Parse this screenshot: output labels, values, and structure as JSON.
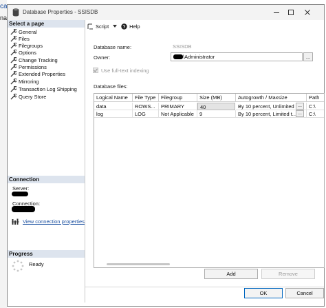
{
  "background": {
    "frag1": "ca",
    "frag2": "na"
  },
  "window": {
    "title": "Database Properties - SSISDB"
  },
  "left_pane": {
    "select_page_header": "Select a page",
    "pages": [
      {
        "label": "General"
      },
      {
        "label": "Files"
      },
      {
        "label": "Filegroups"
      },
      {
        "label": "Options"
      },
      {
        "label": "Change Tracking"
      },
      {
        "label": "Permissions"
      },
      {
        "label": "Extended Properties"
      },
      {
        "label": "Mirroring"
      },
      {
        "label": "Transaction Log Shipping"
      },
      {
        "label": "Query Store"
      }
    ],
    "connection_header": "Connection",
    "server_label": "Server:",
    "connection_label": "Connection:",
    "view_connection_link": "View connection properties",
    "progress_header": "Progress",
    "progress_status": "Ready"
  },
  "toolbar": {
    "script_label": "Script",
    "help_label": "Help"
  },
  "form": {
    "database_name_label": "Database name:",
    "database_name_value": "SSISDB",
    "owner_label": "Owner:",
    "owner_value": "\\Administrator",
    "fulltext_label": "Use full-text indexing",
    "fulltext_checked": true,
    "database_files_label": "Database files:"
  },
  "grid": {
    "columns": [
      "Logical Name",
      "File Type",
      "Filegroup",
      "Size (MB)",
      "Autogrowth / Maxsize",
      "Path"
    ],
    "rows": [
      {
        "logical_name": "data",
        "file_type": "ROWS...",
        "filegroup": "PRIMARY",
        "size": "40",
        "autogrowth": "By 10 percent, Unlimited",
        "path": "C:\\"
      },
      {
        "logical_name": "log",
        "file_type": "LOG",
        "filegroup": "Not Applicable",
        "size": "9",
        "autogrowth": "By 10 percent, Limited t...",
        "path": "C:\\"
      }
    ]
  },
  "buttons": {
    "add": "Add",
    "remove": "Remove",
    "ok": "OK",
    "cancel": "Cancel"
  },
  "colors": {
    "accent": "#0067c0",
    "section_header_bg": "#dde4ee",
    "link": "#1a4fa0"
  }
}
